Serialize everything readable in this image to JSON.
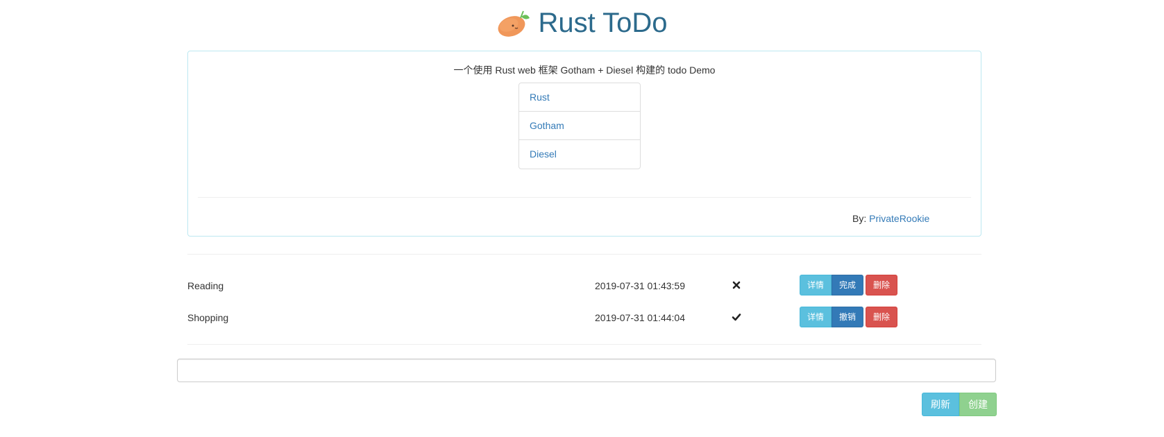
{
  "header": {
    "logo_icon": "mango-icon",
    "title": "Rust ToDo"
  },
  "info": {
    "description": "一个使用 Rust web 框架 Gotham + Diesel 构建的 todo Demo",
    "links": [
      {
        "label": "Rust"
      },
      {
        "label": "Gotham"
      },
      {
        "label": "Diesel"
      }
    ],
    "by_label": "By:",
    "author": "PrivateRookie"
  },
  "todos": [
    {
      "title": "Reading",
      "time": "2019-07-31 01:43:59",
      "status_icon": "cross-icon",
      "done": false,
      "detail_label": "详情",
      "toggle_label": "完成",
      "delete_label": "删除"
    },
    {
      "title": "Shopping",
      "time": "2019-07-31 01:44:04",
      "status_icon": "check-icon",
      "done": true,
      "detail_label": "详情",
      "toggle_label": "撤销",
      "delete_label": "删除"
    }
  ],
  "new_todo": {
    "value": "",
    "placeholder": ""
  },
  "actions": {
    "refresh_label": "刷新",
    "create_label": "创建"
  },
  "colors": {
    "title": "#2c6a8c",
    "link": "#337ab7",
    "info": "#5bc0de",
    "primary": "#337ab7",
    "danger": "#d9534f",
    "success_disabled": "#8fd18f"
  }
}
